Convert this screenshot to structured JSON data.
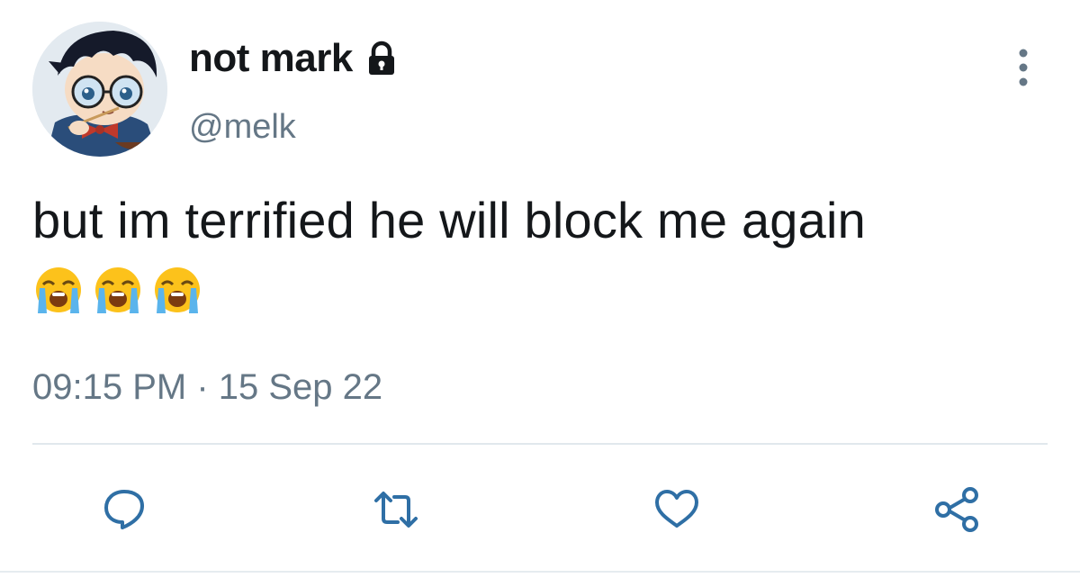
{
  "user": {
    "display_name": "not mark",
    "handle": "@melk",
    "avatar_icon": "avatar-anime-character",
    "protected_icon": "lock-icon"
  },
  "tweet": {
    "text": "but im terrified he will block me again",
    "emojis": [
      "loudly-crying-face-icon",
      "loudly-crying-face-icon",
      "loudly-crying-face-icon"
    ],
    "time": "09:15 PM · 15 Sep 22"
  },
  "actions": {
    "reply_icon": "reply-icon",
    "retweet_icon": "retweet-icon",
    "like_icon": "heart-icon",
    "share_icon": "share-icon"
  },
  "colors": {
    "text": "#14171a",
    "secondary": "#657786",
    "icon": "#2f6fa5",
    "divider": "#e1e8ed"
  }
}
